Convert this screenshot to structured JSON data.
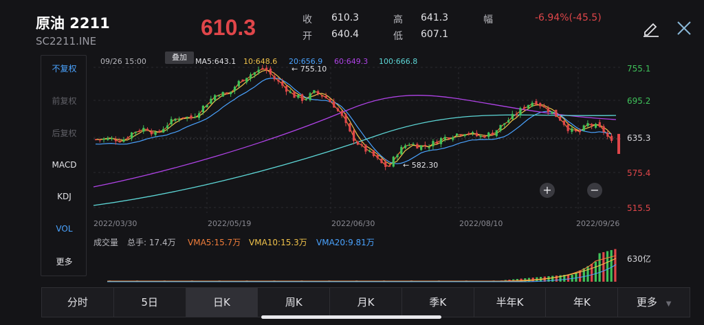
{
  "header": {
    "name": "原油 2211",
    "code": "SC2211.INE",
    "price": "610.3",
    "close_label": "收",
    "close_value": "610.3",
    "open_label": "开",
    "open_value": "640.4",
    "high_label": "高",
    "high_value": "641.3",
    "low_label": "低",
    "low_value": "607.1",
    "change_label": "幅",
    "change_value": "-6.94%(-45.5)",
    "edit_icon": "pencil-icon",
    "close_icon": "close-icon"
  },
  "side_menu": {
    "items": [
      "不复权",
      "前复权",
      "后复权",
      "MACD",
      "KDJ",
      "VOL",
      "更多"
    ]
  },
  "chart_header": {
    "date": "09/26 15:00",
    "overlay_button": "叠加",
    "ma5": "MA5:643.1",
    "ma10": "10:648.6",
    "ma20": "20:656.9",
    "ma60": "60:649.3",
    "ma100": "100:666.8"
  },
  "annotations": {
    "high": "← 755.10",
    "low": "← 582.30"
  },
  "y_axis": [
    "755.1",
    "695.2",
    "635.3",
    "575.4",
    "515.5"
  ],
  "x_axis": [
    "2022/03/30",
    "2022/05/19",
    "2022/06/30",
    "2022/08/10",
    "2022/09/26"
  ],
  "volume_header": {
    "title": "成交量",
    "total": "总手: 17.4万",
    "vma5": "VMA5:15.7万",
    "vma10": "VMA10:15.3万",
    "vma20": "VMA20:9.81万"
  },
  "volume_axis": "630亿",
  "zoom": {
    "plus": "+",
    "minus": "−"
  },
  "periods": [
    "分时",
    "5日",
    "日K",
    "周K",
    "月K",
    "季K",
    "半年K",
    "年K",
    "更多"
  ],
  "active_period": "日K",
  "colors": {
    "up": "#3fc25a",
    "down": "#e0464a",
    "ma5": "#f07d3a",
    "ma10": "#f0c24a",
    "ma20": "#4aa3ff",
    "ma60": "#b043e8",
    "ma100": "#5ed8d8"
  }
}
